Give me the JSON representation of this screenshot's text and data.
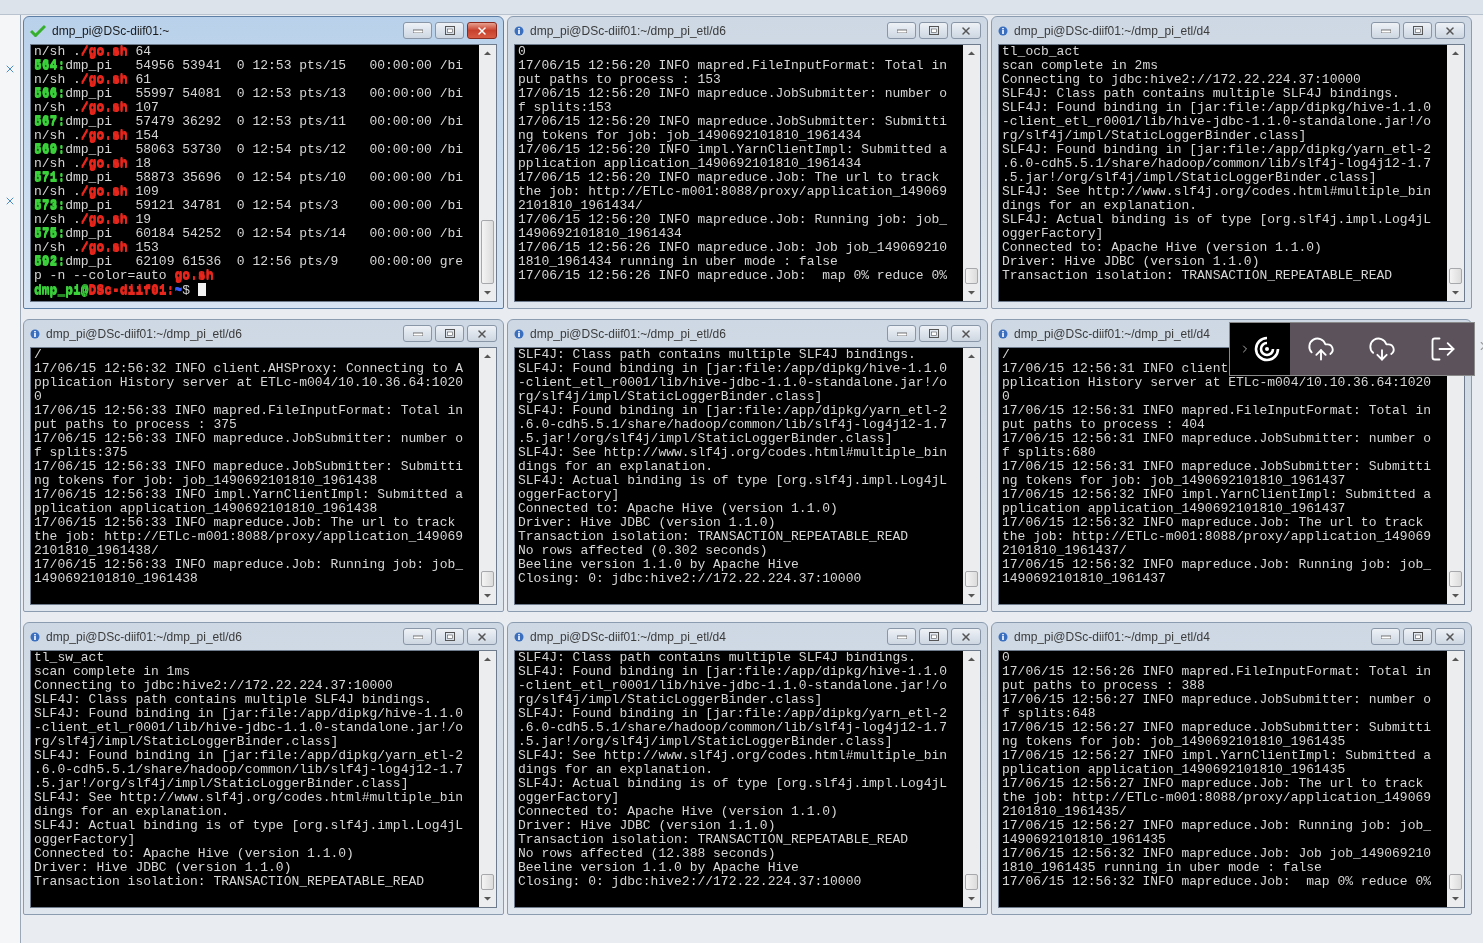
{
  "windows": [
    {
      "title": "dmp_pi@DSc-diif01:~",
      "active": true,
      "controls_visible": true,
      "cursor": true,
      "lines": [
        [
          {
            "text": "n/sh ."
          },
          {
            "text": "/go.sh",
            "color": "#e8261c"
          },
          {
            "text": " 64"
          }
        ],
        [
          {
            "text": "564:",
            "color": "#3bd13b"
          },
          {
            "text": "dmp_pi   54956 53941  0 12:53 pts/15   00:00:00 /bi"
          }
        ],
        [
          {
            "text": "n/sh ."
          },
          {
            "text": "/go.sh",
            "color": "#e8261c"
          },
          {
            "text": " 61"
          }
        ],
        [
          {
            "text": "566:",
            "color": "#3bd13b"
          },
          {
            "text": "dmp_pi   55997 54081  0 12:53 pts/13   00:00:00 /bi"
          }
        ],
        [
          {
            "text": "n/sh ."
          },
          {
            "text": "/go.sh",
            "color": "#e8261c"
          },
          {
            "text": " 107"
          }
        ],
        [
          {
            "text": "567:",
            "color": "#3bd13b"
          },
          {
            "text": "dmp_pi   57479 36292  0 12:53 pts/11   00:00:00 /bi"
          }
        ],
        [
          {
            "text": "n/sh ."
          },
          {
            "text": "/go.sh",
            "color": "#e8261c"
          },
          {
            "text": " 154"
          }
        ],
        [
          {
            "text": "569:",
            "color": "#3bd13b"
          },
          {
            "text": "dmp_pi   58063 53730  0 12:54 pts/12   00:00:00 /bi"
          }
        ],
        [
          {
            "text": "n/sh ."
          },
          {
            "text": "/go.sh",
            "color": "#e8261c"
          },
          {
            "text": " 18"
          }
        ],
        [
          {
            "text": "571:",
            "color": "#3bd13b"
          },
          {
            "text": "dmp_pi   58873 35696  0 12:54 pts/10   00:00:00 /bi"
          }
        ],
        [
          {
            "text": "n/sh ."
          },
          {
            "text": "/go.sh",
            "color": "#e8261c"
          },
          {
            "text": " 109"
          }
        ],
        [
          {
            "text": "573:",
            "color": "#3bd13b"
          },
          {
            "text": "dmp_pi   59121 34781  0 12:54 pts/3    00:00:00 /bi"
          }
        ],
        [
          {
            "text": "n/sh ."
          },
          {
            "text": "/go.sh",
            "color": "#e8261c"
          },
          {
            "text": " 19"
          }
        ],
        [
          {
            "text": "575:",
            "color": "#3bd13b"
          },
          {
            "text": "dmp_pi   60184 54252  0 12:54 pts/14   00:00:00 /bi"
          }
        ],
        [
          {
            "text": "n/sh ."
          },
          {
            "text": "/go.sh",
            "color": "#e8261c"
          },
          {
            "text": " 153"
          }
        ],
        [
          {
            "text": "592:",
            "color": "#3bd13b"
          },
          {
            "text": "dmp_pi   62109 61536  0 12:56 pts/9    00:00:00 gre"
          }
        ],
        [
          {
            "text": "p -n --color=auto "
          },
          {
            "text": "go.sh",
            "color": "#e8261c"
          }
        ],
        [
          {
            "text": "dmp_pi@",
            "color": "#3bd13b"
          },
          {
            "text": "DSc-diif01:",
            "color": "#e8261c"
          },
          {
            "text": "~",
            "color": "#3a5cff"
          },
          {
            "text": "$ "
          }
        ]
      ]
    },
    {
      "title": "dmp_pi@DSc-diif01:~/dmp_pi_etl/d6",
      "active": false,
      "controls_visible": true,
      "cursor": false,
      "lines": [
        "0",
        "17/06/15 12:56:20 INFO mapred.FileInputFormat: Total in",
        "put paths to process : 153",
        "17/06/15 12:56:20 INFO mapreduce.JobSubmitter: number o",
        "f splits:153",
        "17/06/15 12:56:20 INFO mapreduce.JobSubmitter: Submitti",
        "ng tokens for job: job_1490692101810_1961434",
        "17/06/15 12:56:20 INFO impl.YarnClientImpl: Submitted a",
        "pplication application_1490692101810_1961434",
        "17/06/15 12:56:20 INFO mapreduce.Job: The url to track",
        "the job: http://ETLc-m001:8088/proxy/application_149069",
        "2101810_1961434/",
        "17/06/15 12:56:20 INFO mapreduce.Job: Running job: job_",
        "1490692101810_1961434",
        "17/06/15 12:56:26 INFO mapreduce.Job: Job job_149069210",
        "1810_1961434 running in uber mode : false",
        "17/06/15 12:56:26 INFO mapreduce.Job:  map 0% reduce 0%"
      ]
    },
    {
      "title": "dmp_pi@DSc-diif01:~/dmp_pi_etl/d4",
      "active": false,
      "controls_visible": true,
      "cursor": false,
      "lines": [
        "tl_ocb_act",
        "scan complete in 2ms",
        "Connecting to jdbc:hive2://172.22.224.37:10000",
        "SLF4J: Class path contains multiple SLF4J bindings.",
        "SLF4J: Found binding in [jar:file:/app/dipkg/hive-1.1.0",
        "-client_etl_r0001/lib/hive-jdbc-1.1.0-standalone.jar!/o",
        "rg/slf4j/impl/StaticLoggerBinder.class]",
        "SLF4J: Found binding in [jar:file:/app/dipkg/yarn_etl-2",
        ".6.0-cdh5.5.1/share/hadoop/common/lib/slf4j-log4j12-1.7",
        ".5.jar!/org/slf4j/impl/StaticLoggerBinder.class]",
        "SLF4J: See http://www.slf4j.org/codes.html#multiple_bin",
        "dings for an explanation.",
        "SLF4J: Actual binding is of type [org.slf4j.impl.Log4jL",
        "oggerFactory]",
        "Connected to: Apache Hive (version 1.1.0)",
        "Driver: Hive JDBC (version 1.1.0)",
        "Transaction isolation: TRANSACTION_REPEATABLE_READ"
      ]
    },
    {
      "title": "dmp_pi@DSc-diif01:~/dmp_pi_etl/d6",
      "active": false,
      "controls_visible": true,
      "cursor": false,
      "lines": [
        "/",
        "17/06/15 12:56:32 INFO client.AHSProxy: Connecting to A",
        "pplication History server at ETLc-m004/10.10.36.64:1020",
        "0",
        "17/06/15 12:56:33 INFO mapred.FileInputFormat: Total in",
        "put paths to process : 375",
        "17/06/15 12:56:33 INFO mapreduce.JobSubmitter: number o",
        "f splits:375",
        "17/06/15 12:56:33 INFO mapreduce.JobSubmitter: Submitti",
        "ng tokens for job: job_1490692101810_1961438",
        "17/06/15 12:56:33 INFO impl.YarnClientImpl: Submitted a",
        "pplication application_1490692101810_1961438",
        "17/06/15 12:56:33 INFO mapreduce.Job: The url to track",
        "the job: http://ETLc-m001:8088/proxy/application_149069",
        "2101810_1961438/",
        "17/06/15 12:56:33 INFO mapreduce.Job: Running job: job_",
        "1490692101810_1961438"
      ]
    },
    {
      "title": "dmp_pi@DSc-diif01:~/dmp_pi_etl/d6",
      "active": false,
      "controls_visible": true,
      "cursor": false,
      "lines": [
        "SLF4J: Class path contains multiple SLF4J bindings.",
        "SLF4J: Found binding in [jar:file:/app/dipkg/hive-1.1.0",
        "-client_etl_r0001/lib/hive-jdbc-1.1.0-standalone.jar!/o",
        "rg/slf4j/impl/StaticLoggerBinder.class]",
        "SLF4J: Found binding in [jar:file:/app/dipkg/yarn_etl-2",
        ".6.0-cdh5.5.1/share/hadoop/common/lib/slf4j-log4j12-1.7",
        ".5.jar!/org/slf4j/impl/StaticLoggerBinder.class]",
        "SLF4J: See http://www.slf4j.org/codes.html#multiple_bin",
        "dings for an explanation.",
        "SLF4J: Actual binding is of type [org.slf4j.impl.Log4jL",
        "oggerFactory]",
        "Connected to: Apache Hive (version 1.1.0)",
        "Driver: Hive JDBC (version 1.1.0)",
        "Transaction isolation: TRANSACTION_REPEATABLE_READ",
        "No rows affected (0.302 seconds)",
        "Beeline version 1.1.0 by Apache Hive",
        "Closing: 0: jdbc:hive2://172.22.224.37:10000"
      ]
    },
    {
      "title": "dmp_pi@DSc-diif01:~/dmp_pi_etl/d4",
      "active": false,
      "controls_visible": false,
      "cursor": false,
      "lines": [
        "/",
        "17/06/15 12:56:31 INFO client",
        "pplication History server at ETLc-m004/10.10.36.64:1020",
        "0",
        "17/06/15 12:56:31 INFO mapred.FileInputFormat: Total in",
        "put paths to process : 404",
        "17/06/15 12:56:31 INFO mapreduce.JobSubmitter: number o",
        "f splits:680",
        "17/06/15 12:56:31 INFO mapreduce.JobSubmitter: Submitti",
        "ng tokens for job: job_1490692101810_1961437",
        "17/06/15 12:56:32 INFO impl.YarnClientImpl: Submitted a",
        "pplication application_1490692101810_1961437",
        "17/06/15 12:56:32 INFO mapreduce.Job: The url to track",
        "the job: http://ETLc-m001:8088/proxy/application_149069",
        "2101810_1961437/",
        "17/06/15 12:56:32 INFO mapreduce.Job: Running job: job_",
        "1490692101810_1961437"
      ]
    },
    {
      "title": "dmp_pi@DSc-diif01:~/dmp_pi_etl/d6",
      "active": false,
      "controls_visible": true,
      "cursor": false,
      "lines": [
        "tl_sw_act",
        "scan complete in 1ms",
        "Connecting to jdbc:hive2://172.22.224.37:10000",
        "SLF4J: Class path contains multiple SLF4J bindings.",
        "SLF4J: Found binding in [jar:file:/app/dipkg/hive-1.1.0",
        "-client_etl_r0001/lib/hive-jdbc-1.1.0-standalone.jar!/o",
        "rg/slf4j/impl/StaticLoggerBinder.class]",
        "SLF4J: Found binding in [jar:file:/app/dipkg/yarn_etl-2",
        ".6.0-cdh5.5.1/share/hadoop/common/lib/slf4j-log4j12-1.7",
        ".5.jar!/org/slf4j/impl/StaticLoggerBinder.class]",
        "SLF4J: See http://www.slf4j.org/codes.html#multiple_bin",
        "dings for an explanation.",
        "SLF4J: Actual binding is of type [org.slf4j.impl.Log4jL",
        "oggerFactory]",
        "Connected to: Apache Hive (version 1.1.0)",
        "Driver: Hive JDBC (version 1.1.0)",
        "Transaction isolation: TRANSACTION_REPEATABLE_READ"
      ]
    },
    {
      "title": "dmp_pi@DSc-diif01:~/dmp_pi_etl/d4",
      "active": false,
      "controls_visible": true,
      "cursor": false,
      "lines": [
        "SLF4J: Class path contains multiple SLF4J bindings.",
        "SLF4J: Found binding in [jar:file:/app/dipkg/hive-1.1.0",
        "-client_etl_r0001/lib/hive-jdbc-1.1.0-standalone.jar!/o",
        "rg/slf4j/impl/StaticLoggerBinder.class]",
        "SLF4J: Found binding in [jar:file:/app/dipkg/yarn_etl-2",
        ".6.0-cdh5.5.1/share/hadoop/common/lib/slf4j-log4j12-1.7",
        ".5.jar!/org/slf4j/impl/StaticLoggerBinder.class]",
        "SLF4J: See http://www.slf4j.org/codes.html#multiple_bin",
        "dings for an explanation.",
        "SLF4J: Actual binding is of type [org.slf4j.impl.Log4jL",
        "oggerFactory]",
        "Connected to: Apache Hive (version 1.1.0)",
        "Driver: Hive JDBC (version 1.1.0)",
        "Transaction isolation: TRANSACTION_REPEATABLE_READ",
        "No rows affected (12.388 seconds)",
        "Beeline version 1.1.0 by Apache Hive",
        "Closing: 0: jdbc:hive2://172.22.224.37:10000"
      ]
    },
    {
      "title": "dmp_pi@DSc-diif01:~/dmp_pi_etl/d4",
      "active": false,
      "controls_visible": true,
      "cursor": false,
      "lines": [
        "0",
        "17/06/15 12:56:26 INFO mapred.FileInputFormat: Total in",
        "put paths to process : 388",
        "17/06/15 12:56:27 INFO mapreduce.JobSubmitter: number o",
        "f splits:648",
        "17/06/15 12:56:27 INFO mapreduce.JobSubmitter: Submitti",
        "ng tokens for job: job_1490692101810_1961435",
        "17/06/15 12:56:27 INFO impl.YarnClientImpl: Submitted a",
        "pplication application_1490692101810_1961435",
        "17/06/15 12:56:27 INFO mapreduce.Job: The url to track",
        "the job: http://ETLc-m001:8088/proxy/application_149069",
        "2101810_1961435/",
        "17/06/15 12:56:27 INFO mapreduce.Job: Running job: job_",
        "1490692101810_1961435",
        "17/06/15 12:56:32 INFO mapreduce.Job: Job job_149069210",
        "1810_1961435 running in uber mode : false",
        "17/06/15 12:56:32 INFO mapreduce.Job:  map 0% reduce 0%"
      ]
    }
  ]
}
